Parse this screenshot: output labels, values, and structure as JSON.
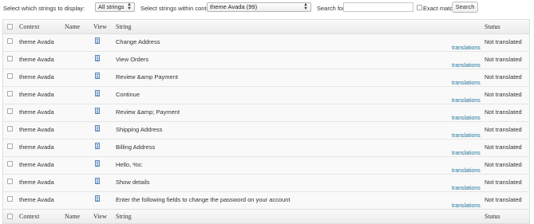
{
  "filters": {
    "display_label": "Select which strings to display:",
    "display_value": "All strings",
    "context_label": "Select strings within context:",
    "context_value": "theme Avada (99)",
    "search_label": "Search for:",
    "search_value": "",
    "exact_match_label": "Exact match",
    "search_button": "Search"
  },
  "table": {
    "columns": {
      "context": "Context",
      "name": "Name",
      "view": "View",
      "string": "String",
      "status": "Status"
    },
    "link_label": "translations",
    "rows": [
      {
        "context": "theme Avada",
        "name": "",
        "string": "Change Address",
        "status": "Not translated"
      },
      {
        "context": "theme Avada",
        "name": "",
        "string": "View Orders",
        "status": "Not translated"
      },
      {
        "context": "theme Avada",
        "name": "",
        "string": "Review &amp Payment",
        "status": "Not translated"
      },
      {
        "context": "theme Avada",
        "name": "",
        "string": "Continue",
        "status": "Not translated"
      },
      {
        "context": "theme Avada",
        "name": "",
        "string": "Review &amp; Payment",
        "status": "Not translated"
      },
      {
        "context": "theme Avada",
        "name": "",
        "string": "Shipping Address",
        "status": "Not translated"
      },
      {
        "context": "theme Avada",
        "name": "",
        "string": "Billing Address",
        "status": "Not translated"
      },
      {
        "context": "theme Avada",
        "name": "",
        "string": "Hello, %s:",
        "status": "Not translated"
      },
      {
        "context": "theme Avada",
        "name": "",
        "string": "Show details",
        "status": "Not translated"
      },
      {
        "context": "theme Avada",
        "name": "",
        "string": "Enter the following fields to change the password on your account",
        "status": "Not translated"
      }
    ]
  },
  "icons": {
    "view": "document-icon",
    "checkbox": "checkbox-icon",
    "select_arrow": "updown-arrow-icon"
  },
  "colors": {
    "link": "#21759b",
    "header_bg": "#f1f1f1",
    "row_bg": "#f9f9f9"
  }
}
